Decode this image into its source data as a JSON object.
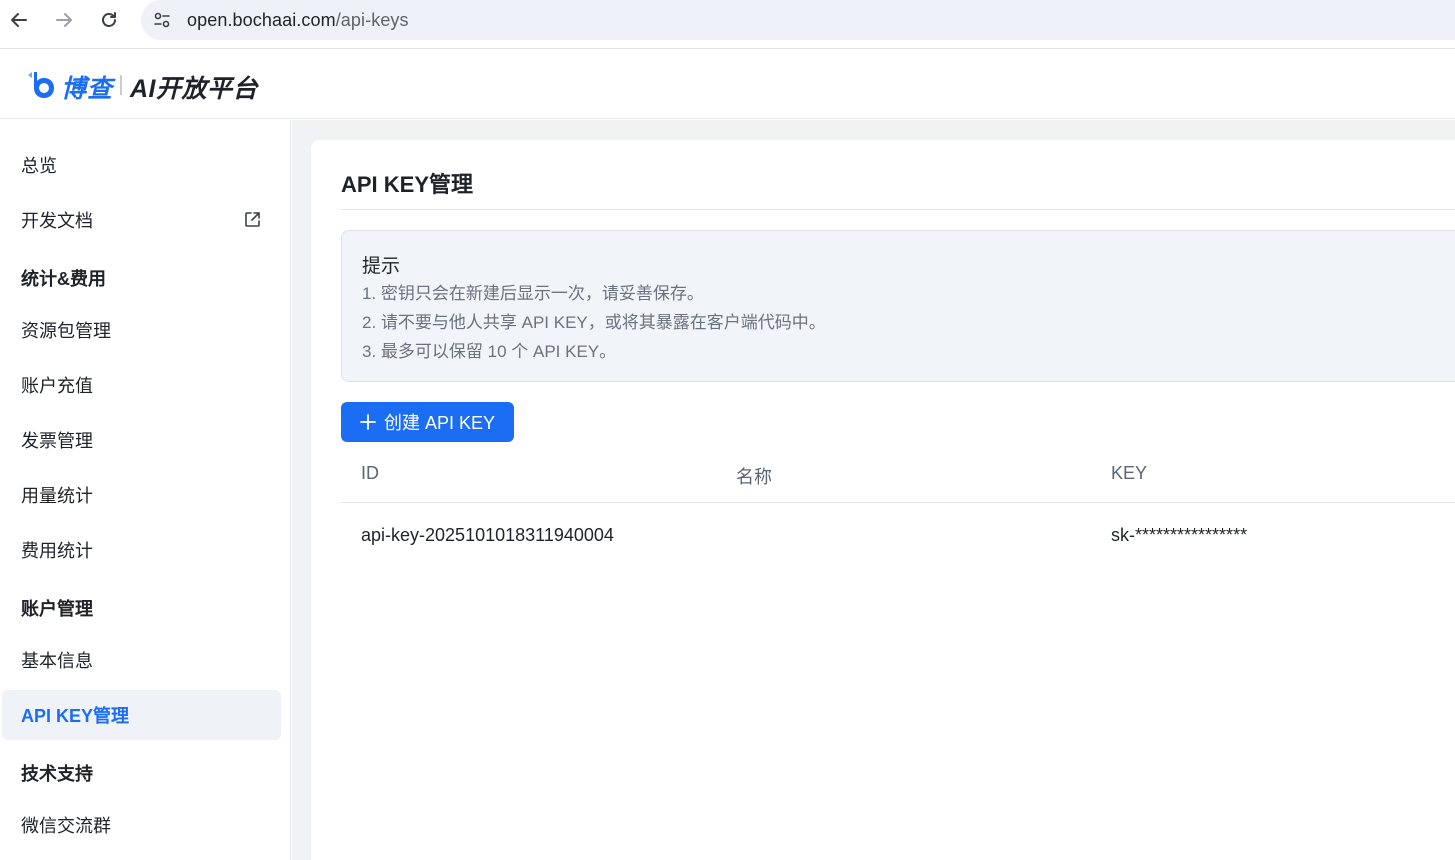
{
  "browser": {
    "url_host": "open.bochaai.com",
    "url_path": "/api-keys"
  },
  "header": {
    "brand": "博查",
    "platform": "AI开放平台"
  },
  "sidebar": {
    "items": [
      {
        "label": "总览"
      },
      {
        "label": "开发文档"
      },
      {
        "label": "统计&费用"
      },
      {
        "label": "资源包管理"
      },
      {
        "label": "账户充值"
      },
      {
        "label": "发票管理"
      },
      {
        "label": "用量统计"
      },
      {
        "label": "费用统计"
      },
      {
        "label": "账户管理"
      },
      {
        "label": "基本信息"
      },
      {
        "label": "API KEY管理"
      },
      {
        "label": "技术支持"
      },
      {
        "label": "微信交流群"
      }
    ]
  },
  "main": {
    "title": "API KEY管理",
    "tip": {
      "title": "提示",
      "lines": [
        "1. 密钥只会在新建后显示一次，请妥善保存。",
        "2. 请不要与他人共享 API KEY，或将其暴露在客户端代码中。",
        "3. 最多可以保留 10 个 API KEY。"
      ]
    },
    "create_button": "创建 API KEY",
    "table": {
      "columns": [
        "ID",
        "名称",
        "KEY"
      ],
      "rows": [
        {
          "id": "api-key-2025101018311940004",
          "name": "",
          "key": "sk-****************"
        }
      ]
    }
  },
  "colors": {
    "accent": "#1b6ef3",
    "content_bg": "#f0f2f6",
    "tip_bg": "#f1f4f8"
  },
  "icons": [
    "back-arrow-icon",
    "forward-arrow-icon",
    "reload-icon",
    "site-settings-icon",
    "external-link-icon",
    "plus-icon",
    "logo-icon"
  ]
}
